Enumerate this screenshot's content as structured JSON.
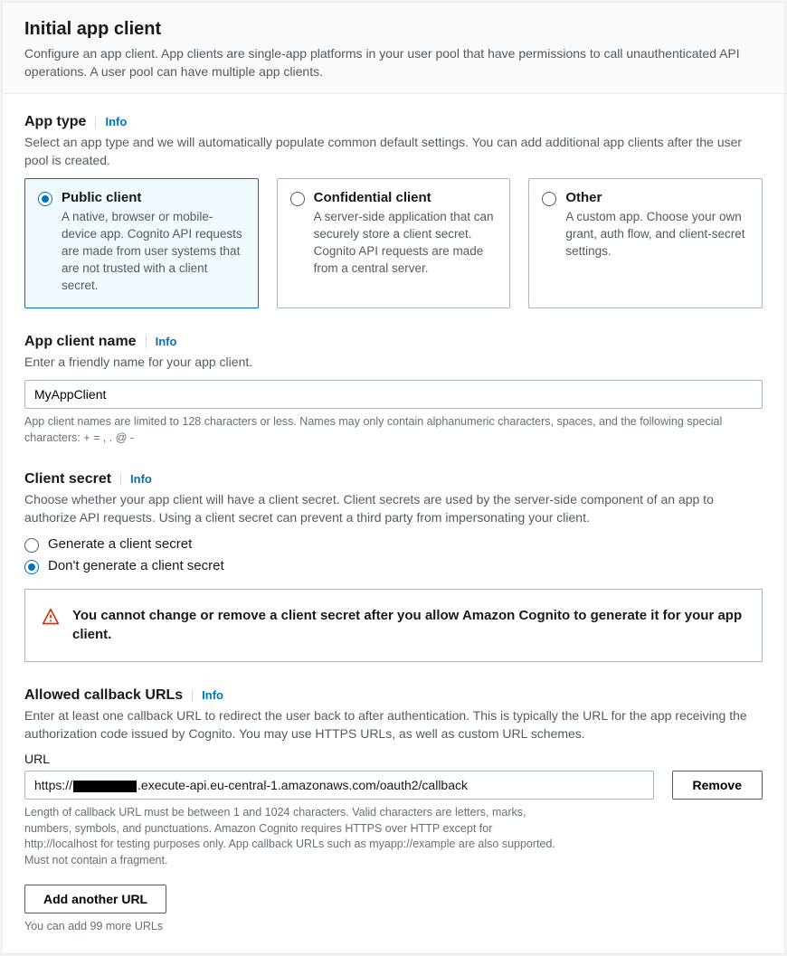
{
  "header": {
    "title": "Initial app client",
    "desc": "Configure an app client. App clients are single-app platforms in your user pool that have permissions to call unauthenticated API operations. A user pool can have multiple app clients."
  },
  "info_label": "Info",
  "app_type": {
    "heading": "App type",
    "desc": "Select an app type and we will automatically populate common default settings. You can add additional app clients after the user pool is created.",
    "options": [
      {
        "title": "Public client",
        "desc": "A native, browser or mobile-device app. Cognito API requests are made from user systems that are not trusted with a client secret.",
        "selected": true
      },
      {
        "title": "Confidential client",
        "desc": "A server-side application that can securely store a client secret. Cognito API requests are made from a central server.",
        "selected": false
      },
      {
        "title": "Other",
        "desc": "A custom app. Choose your own grant, auth flow, and client-secret settings.",
        "selected": false
      }
    ]
  },
  "client_name": {
    "heading": "App client name",
    "desc": "Enter a friendly name for your app client.",
    "value": "MyAppClient",
    "help": "App client names are limited to 128 characters or less. Names may only contain alphanumeric characters, spaces, and the following special characters: + = , . @ -"
  },
  "client_secret": {
    "heading": "Client secret",
    "desc": "Choose whether your app client will have a client secret. Client secrets are used by the server-side component of an app to authorize API requests. Using a client secret can prevent a third party from impersonating your client.",
    "options": [
      {
        "label": "Generate a client secret",
        "selected": false
      },
      {
        "label": "Don't generate a client secret",
        "selected": true
      }
    ],
    "alert": "You cannot change or remove a client secret after you allow Amazon Cognito to generate it for your app client."
  },
  "callback_urls": {
    "heading": "Allowed callback URLs",
    "desc": "Enter at least one callback URL to redirect the user back to after authentication. This is typically the URL for the app receiving the authorization code issued by Cognito. You may use HTTPS URLs, as well as custom URL schemes.",
    "field_label": "URL",
    "url_prefix": "https://",
    "url_suffix": ".execute-api.eu-central-1.amazonaws.com/oauth2/callback",
    "remove_label": "Remove",
    "help": "Length of callback URL must be between 1 and 1024 characters. Valid characters are letters, marks, numbers, symbols, and punctuations. Amazon Cognito requires HTTPS over HTTP except for http://localhost for testing purposes only. App callback URLs such as myapp://example are also supported. Must not contain a fragment.",
    "add_button": "Add another URL",
    "add_help": "You can add 99 more URLs"
  }
}
